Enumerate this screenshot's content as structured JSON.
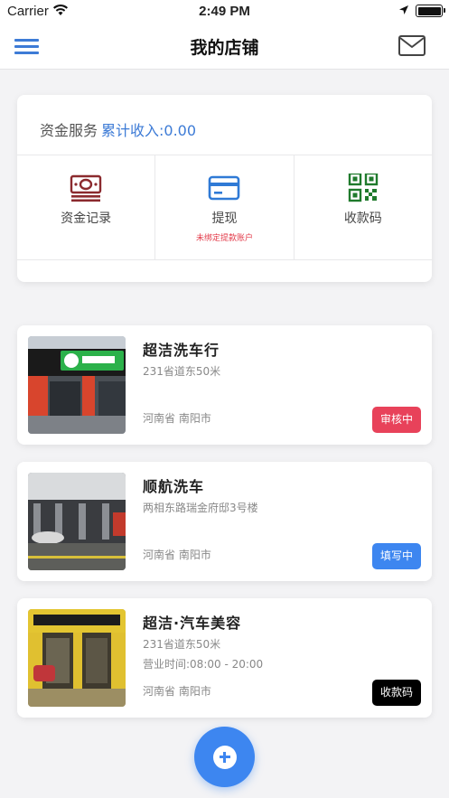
{
  "status_bar": {
    "carrier": "Carrier",
    "time": "2:49 PM"
  },
  "nav": {
    "title": "我的店铺",
    "menu_icon": "hamburger-menu-icon",
    "mail_icon": "envelope-icon",
    "accent": "#3d7bd6"
  },
  "finance": {
    "label": "资金服务",
    "income_text": "累计收入:0.00",
    "items": [
      {
        "label": "资金记录",
        "icon": "money-bill-icon",
        "sub": ""
      },
      {
        "label": "提现",
        "icon": "card-icon",
        "sub": "未绑定提款账户"
      },
      {
        "label": "收款码",
        "icon": "qr-code-icon",
        "sub": ""
      }
    ]
  },
  "stores": [
    {
      "name": "超洁洗车行",
      "address": "231省道东50米",
      "hours": "",
      "region": "河南省 南阳市",
      "status": "审核中",
      "status_color": "#e8425a"
    },
    {
      "name": "顺航洗车",
      "address": "两相东路瑞金府邸3号楼",
      "hours": "",
      "region": "河南省 南阳市",
      "status": "填写中",
      "status_color": "#3d86f0"
    },
    {
      "name": "超洁·汽车美容",
      "address": "231省道东50米",
      "hours": "营业时间:08:00 - 20:00",
      "region": "河南省 南阳市",
      "status": "收款码",
      "status_color": "#000000"
    }
  ],
  "fab": {
    "icon": "plus-icon"
  }
}
